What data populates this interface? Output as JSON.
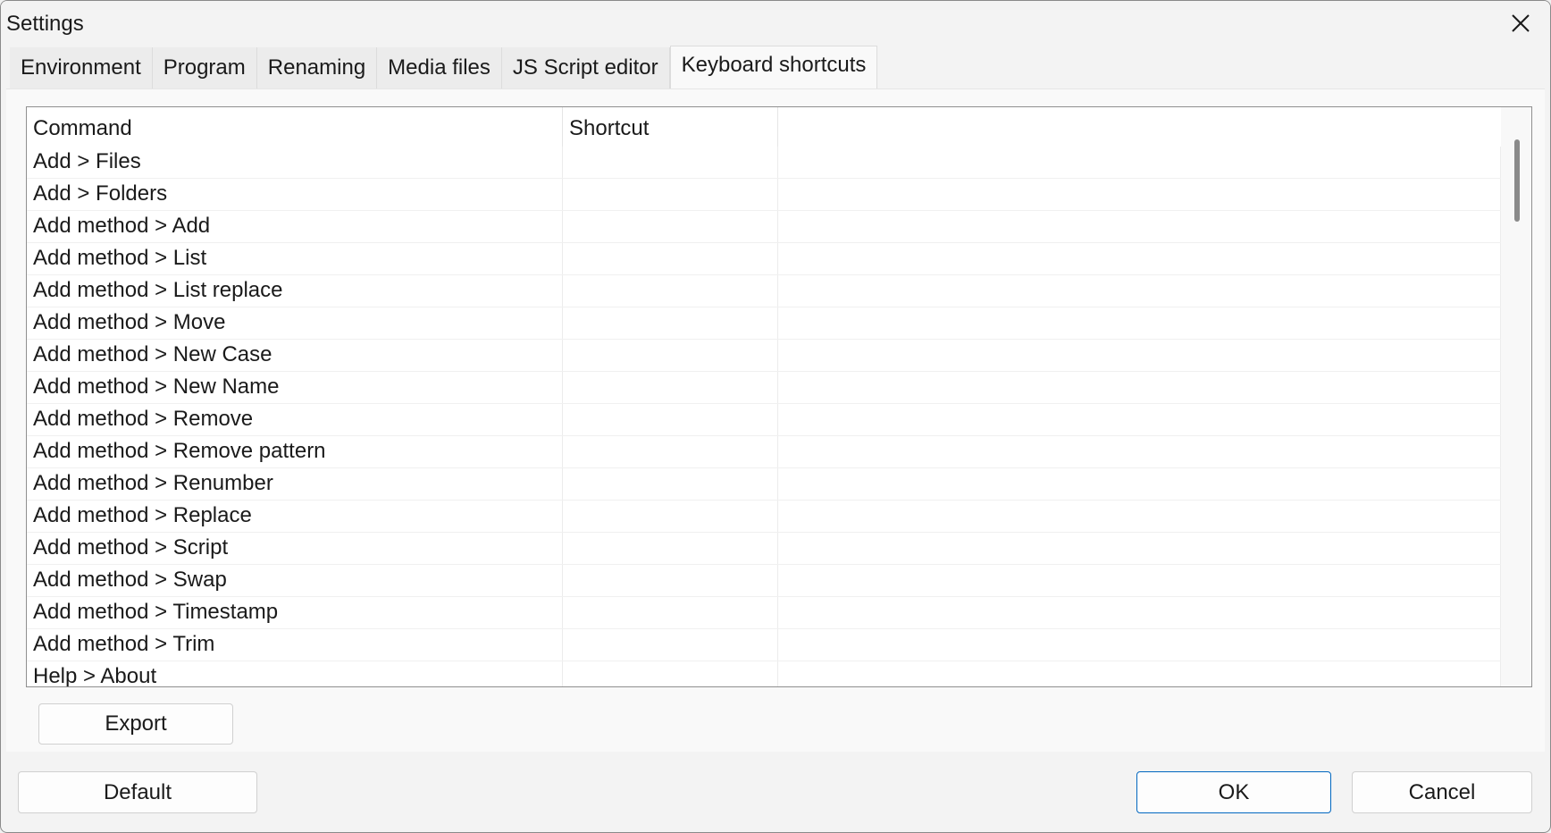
{
  "window": {
    "title": "Settings"
  },
  "tabs": [
    {
      "label": "Environment"
    },
    {
      "label": "Program"
    },
    {
      "label": "Renaming"
    },
    {
      "label": "Media files"
    },
    {
      "label": "JS Script editor"
    },
    {
      "label": "Keyboard shortcuts",
      "active": true
    }
  ],
  "table": {
    "columns": [
      "Command",
      "Shortcut",
      ""
    ],
    "rows": [
      {
        "command": "Add > Files",
        "shortcut": ""
      },
      {
        "command": "Add > Folders",
        "shortcut": ""
      },
      {
        "command": "Add method > Add",
        "shortcut": ""
      },
      {
        "command": "Add method > List",
        "shortcut": ""
      },
      {
        "command": "Add method > List replace",
        "shortcut": ""
      },
      {
        "command": "Add method > Move",
        "shortcut": ""
      },
      {
        "command": "Add method > New Case",
        "shortcut": ""
      },
      {
        "command": "Add method > New Name",
        "shortcut": ""
      },
      {
        "command": "Add method > Remove",
        "shortcut": ""
      },
      {
        "command": "Add method > Remove pattern",
        "shortcut": ""
      },
      {
        "command": "Add method > Renumber",
        "shortcut": ""
      },
      {
        "command": "Add method > Replace",
        "shortcut": ""
      },
      {
        "command": "Add method > Script",
        "shortcut": ""
      },
      {
        "command": "Add method > Swap",
        "shortcut": ""
      },
      {
        "command": "Add method > Timestamp",
        "shortcut": ""
      },
      {
        "command": "Add method > Trim",
        "shortcut": ""
      },
      {
        "command": "Help > About",
        "shortcut": ""
      }
    ]
  },
  "buttons": {
    "export": "Export",
    "default": "Default",
    "ok": "OK",
    "cancel": "Cancel"
  },
  "icons": {
    "close": "close-icon"
  },
  "colors": {
    "accent": "#0067c0"
  }
}
